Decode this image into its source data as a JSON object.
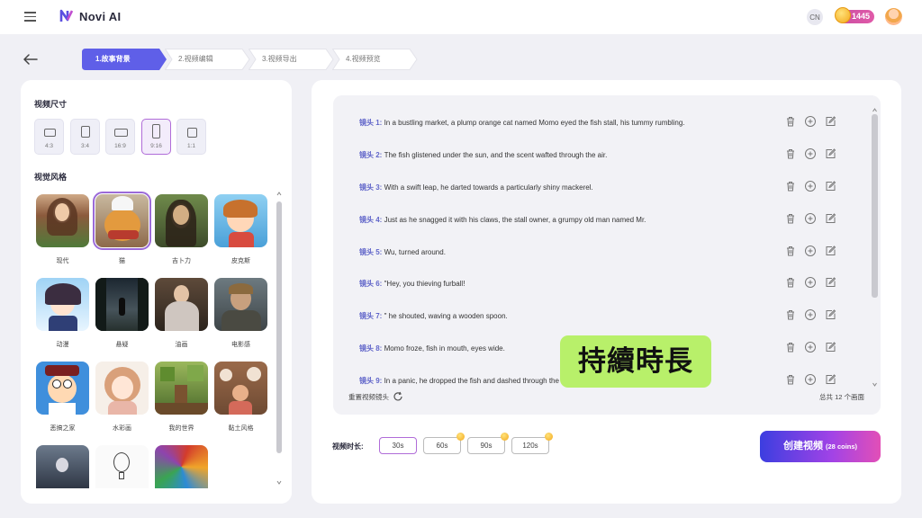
{
  "app": {
    "name": "Novi AI"
  },
  "header": {
    "coins": "1445",
    "lang_badge": "CN"
  },
  "steps": [
    {
      "label": "1.故事背景",
      "active": true
    },
    {
      "label": "2.视频编辑",
      "active": false
    },
    {
      "label": "3.视频导出",
      "active": false
    },
    {
      "label": "4.视频预览",
      "active": false
    }
  ],
  "left": {
    "size_title": "视频尺寸",
    "ratios": [
      {
        "label": "4:3",
        "selected": false
      },
      {
        "label": "3:4",
        "selected": false
      },
      {
        "label": "16:9",
        "selected": false
      },
      {
        "label": "9:16",
        "selected": true
      },
      {
        "label": "1:1",
        "selected": false
      }
    ],
    "style_title": "视觉风格",
    "styles": [
      {
        "label": "现代",
        "selected": false
      },
      {
        "label": "猫",
        "selected": true
      },
      {
        "label": "吉卜力",
        "selected": false
      },
      {
        "label": "皮克斯",
        "selected": false
      },
      {
        "label": "动漫",
        "selected": false
      },
      {
        "label": "悬疑",
        "selected": false
      },
      {
        "label": "油画",
        "selected": false
      },
      {
        "label": "电影感",
        "selected": false
      },
      {
        "label": "恶搞之家",
        "selected": false
      },
      {
        "label": "水彩画",
        "selected": false
      },
      {
        "label": "我的世界",
        "selected": false
      },
      {
        "label": "黏土风格",
        "selected": false
      },
      {
        "label": "",
        "selected": false
      },
      {
        "label": "",
        "selected": false
      },
      {
        "label": "",
        "selected": false
      }
    ]
  },
  "scenes": [
    {
      "label": "镜头 1:",
      "text": "In a bustling market, a plump orange cat named Momo eyed the fish stall, his tummy rumbling."
    },
    {
      "label": "镜头 2:",
      "text": "The fish glistened under the sun, and the scent wafted through the air."
    },
    {
      "label": "镜头 3:",
      "text": "With a swift leap, he darted towards a particularly shiny mackerel."
    },
    {
      "label": "镜头 4:",
      "text": "Just as he snagged it with his claws, the stall owner, a grumpy old man named Mr."
    },
    {
      "label": "镜头 5:",
      "text": "Wu, turned around."
    },
    {
      "label": "镜头 6:",
      "text": "\"Hey, you thieving furball!"
    },
    {
      "label": "镜头 7:",
      "text": "\" he shouted, waving a wooden spoon."
    },
    {
      "label": "镜头 8:",
      "text": "Momo froze, fish in mouth, eyes wide."
    },
    {
      "label": "镜头 9:",
      "text": "In a panic, he dropped the fish and dashed through the crowd, narrowly avoiding baskets."
    }
  ],
  "scene_footer": {
    "reset": "重置视频镜头",
    "total": "总共 12 个画面"
  },
  "duration": {
    "label": "视频时长:",
    "options": [
      {
        "label": "30s",
        "selected": true,
        "premium": false
      },
      {
        "label": "60s",
        "selected": false,
        "premium": true
      },
      {
        "label": "90s",
        "selected": false,
        "premium": true
      },
      {
        "label": "120s",
        "selected": false,
        "premium": true
      }
    ]
  },
  "create": {
    "label": "创建视频",
    "cost": "(28 coins)"
  },
  "overlay": {
    "text": "持續時長"
  }
}
